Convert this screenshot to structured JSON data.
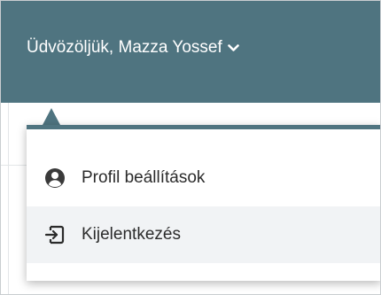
{
  "header": {
    "greeting": "Üdvözöljük, Mazza Yossef",
    "toggle_icon": "chevron-down-icon"
  },
  "dropdown": {
    "items": [
      {
        "label": "Profil beállítások",
        "icon": "user-circle-icon"
      },
      {
        "label": "Kijelentkezés",
        "icon": "sign-out-icon"
      }
    ]
  },
  "colors": {
    "header_bg": "#4f7480",
    "hover_bg": "#f1f3f5",
    "text": "#2b2b2b"
  }
}
